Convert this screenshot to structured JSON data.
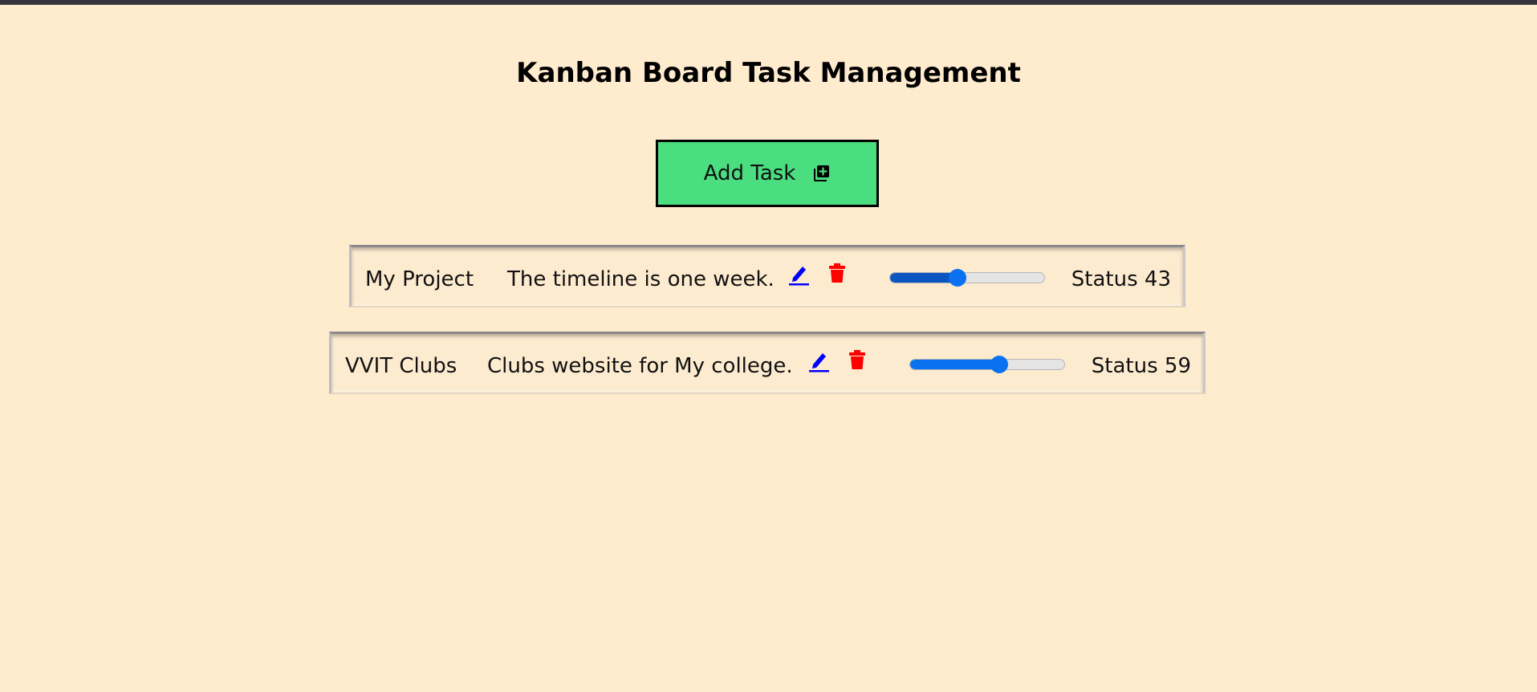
{
  "header": {
    "title": "Kanban Board Task Management"
  },
  "toolbar": {
    "add_task_label": "Add Task",
    "add_task_icon": "add-box-icon"
  },
  "colors": {
    "page_background": "#ffebcd",
    "top_bar": "#34343e",
    "add_button": "#4ade80",
    "edit_icon": "#0000ff",
    "delete_icon": "#ff0000",
    "slider_active": "#0a72f0"
  },
  "tasks": [
    {
      "title": "My Project",
      "description": "The timeline is one week.",
      "edit_icon": "pencil-icon",
      "delete_icon": "trash-icon",
      "progress": 43,
      "status_label": "Status 43",
      "slider_color": "#0b57c2"
    },
    {
      "title": "VVIT Clubs",
      "description": "Clubs website for My college.",
      "edit_icon": "pencil-icon",
      "delete_icon": "trash-icon",
      "progress": 59,
      "status_label": "Status 59",
      "slider_color": "#0a72f0"
    }
  ]
}
